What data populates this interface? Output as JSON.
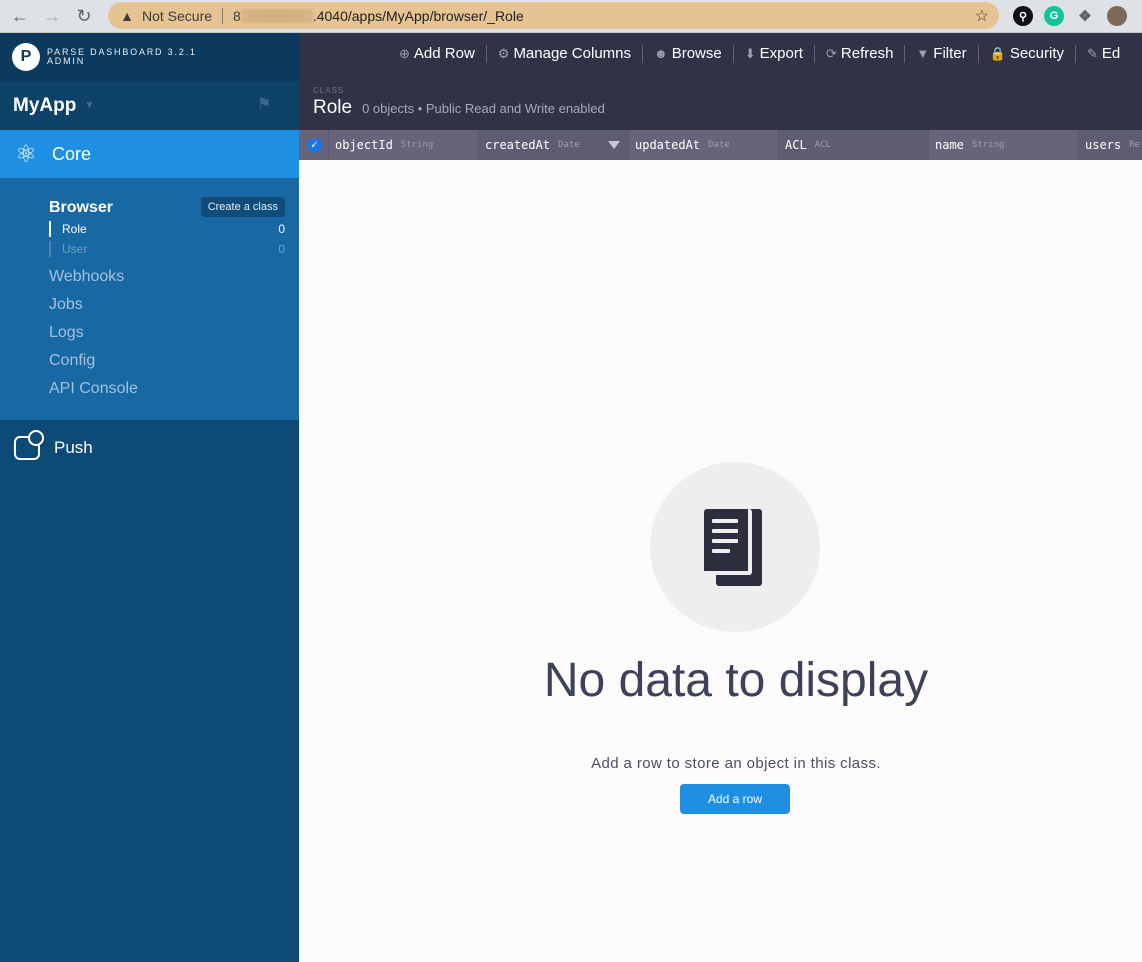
{
  "browser": {
    "security_label": "Not Secure",
    "url_visible": ".4040/apps/MyApp/browser/_Role"
  },
  "sidebar": {
    "brand_line1": "PARSE DASHBOARD 3.2.1",
    "brand_line2": "ADMIN",
    "app_name": "MyApp",
    "core_label": "Core",
    "browser_label": "Browser",
    "create_class_label": "Create a class",
    "classes": [
      {
        "name": "Role",
        "count": "0"
      },
      {
        "name": "User",
        "count": "0"
      }
    ],
    "links": [
      "Webhooks",
      "Jobs",
      "Logs",
      "Config",
      "API Console"
    ],
    "push_label": "Push"
  },
  "toolbar": {
    "add_row": "Add Row",
    "manage_columns": "Manage Columns",
    "browse": "Browse",
    "export": "Export",
    "refresh": "Refresh",
    "filter": "Filter",
    "security": "Security",
    "edit_truncated": "Ed"
  },
  "class_header": {
    "kicker": "CLASS",
    "name": "Role",
    "subtitle": "0 objects • Public Read and Write enabled"
  },
  "columns": [
    {
      "name": "objectId",
      "type": "String"
    },
    {
      "name": "createdAt",
      "type": "Date"
    },
    {
      "name": "updatedAt",
      "type": "Date"
    },
    {
      "name": "ACL",
      "type": "ACL"
    },
    {
      "name": "name",
      "type": "String"
    },
    {
      "name": "users",
      "type": "Re"
    }
  ],
  "empty_state": {
    "title": "No data to display",
    "description": "Add a row to store an object in this class.",
    "button": "Add a row"
  },
  "colors": {
    "sidebar": "#0e4a77",
    "accent": "#1e8fe3",
    "toolbar": "#2f3345",
    "column_header": "#66637a"
  }
}
